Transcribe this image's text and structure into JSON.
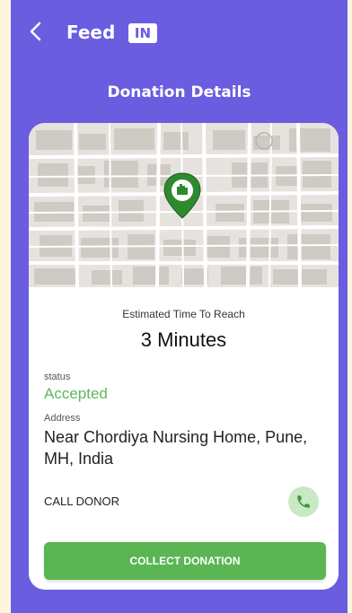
{
  "header": {
    "logo_text": "Feed",
    "logo_badge": "IN",
    "back_icon": "chevron-left-icon"
  },
  "page": {
    "title": "Donation Details"
  },
  "map": {
    "marker_icon": "map-pin-hand-icon"
  },
  "details": {
    "eta_label": "Estimated Time To Reach",
    "eta_value": "3 Minutes",
    "status_label": "status",
    "status_value": "Accepted",
    "address_label": "Address",
    "address_value": "Near Chordiya Nursing Home, Pune, MH, India",
    "call_label": "CALL DONOR",
    "call_icon": "phone-icon",
    "collect_label": "COLLECT DONATION"
  },
  "colors": {
    "primary": "#6a5de0",
    "accent_green": "#5ab553",
    "outer_background": "#fbf6dc"
  }
}
